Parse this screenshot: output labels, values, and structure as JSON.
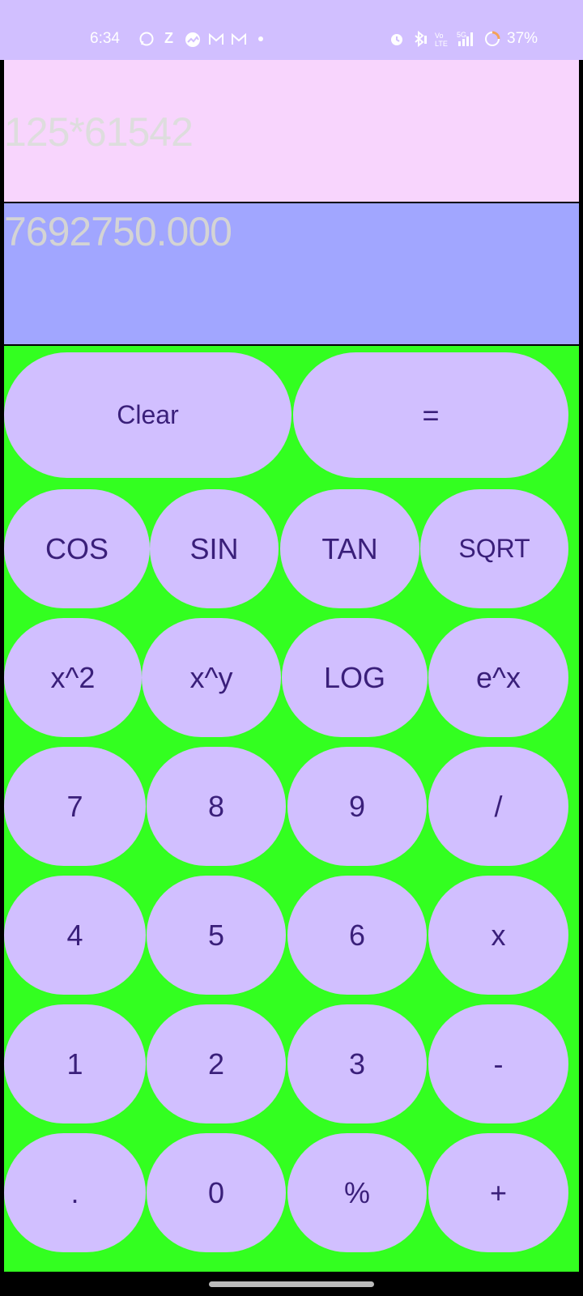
{
  "status_bar": {
    "time": "6:34",
    "battery": "37%",
    "left_icons": [
      "whatsapp-icon",
      "z-icon",
      "photos-icon",
      "gmail-icon",
      "gmail-icon",
      "dot-icon"
    ],
    "right_icons": [
      "alarm-icon",
      "bluetooth-icon",
      "volte-icon",
      "5g-signal-icon",
      "battery-saver-icon"
    ]
  },
  "display": {
    "expression": "125*61542",
    "result": "7692750.000"
  },
  "keys": {
    "clear": "Clear",
    "equals": "=",
    "cos": "COS",
    "sin": "SIN",
    "tan": "TAN",
    "sqrt": "SQRT",
    "square": "x^2",
    "power": "x^y",
    "log": "LOG",
    "exp": "e^x",
    "seven": "7",
    "eight": "8",
    "nine": "9",
    "divide": "/",
    "four": "4",
    "five": "5",
    "six": "6",
    "multiply": "x",
    "one": "1",
    "two": "2",
    "three": "3",
    "minus": "-",
    "dot": ".",
    "zero": "0",
    "percent": "%",
    "plus": "+"
  },
  "colors": {
    "status_bar": "#d1bfff",
    "expression_bg": "#f8d5fd",
    "result_bg": "#a1a6ff",
    "keypad_bg": "#33ff20",
    "key_bg": "#d1bfff",
    "key_text": "#3a1f7a"
  }
}
